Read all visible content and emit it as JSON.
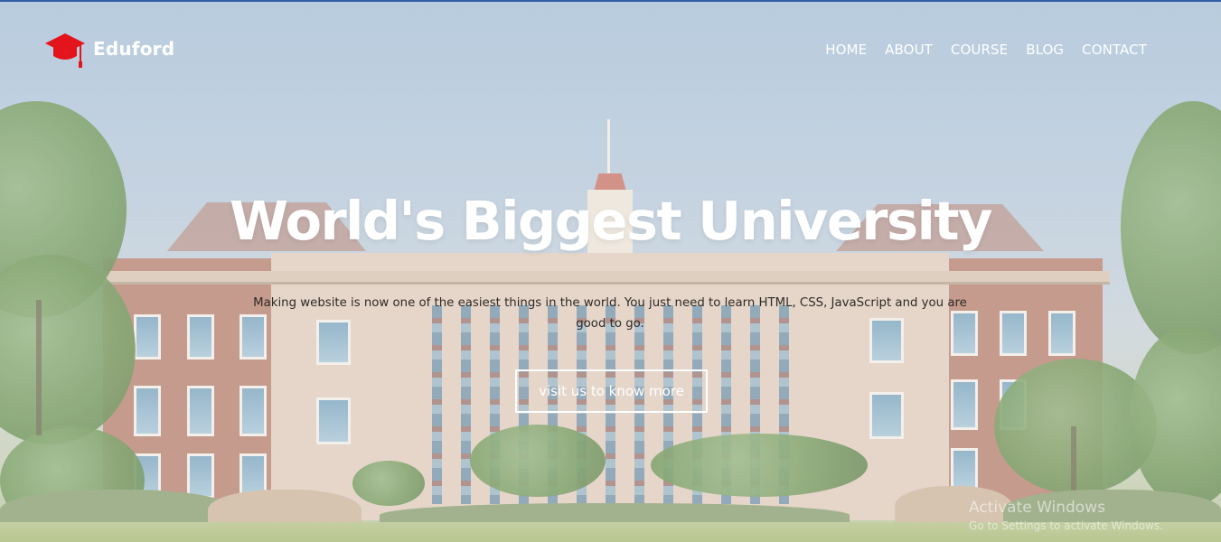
{
  "brand": {
    "name": "Eduford",
    "icon": "graduation-cap-icon",
    "icon_color": "#e3141b"
  },
  "nav": {
    "items": [
      {
        "label": "HOME"
      },
      {
        "label": "ABOUT"
      },
      {
        "label": "COURSE"
      },
      {
        "label": "BLOG"
      },
      {
        "label": "CONTACT"
      }
    ]
  },
  "hero": {
    "title": "World's Biggest University",
    "subtitle": "Making website is now one of the easiest things in the world. You just need to learn HTML, CSS, JavaScript and you are good to go.",
    "cta_label": "visit us to know more",
    "background_image": "university-building-photo"
  },
  "watermark": {
    "title": "Activate Windows",
    "subtitle": "Go to Settings to activate Windows."
  },
  "colors": {
    "text_light": "#ffffff",
    "text_dark": "#2e2a26",
    "top_border": "#2f5da8"
  }
}
